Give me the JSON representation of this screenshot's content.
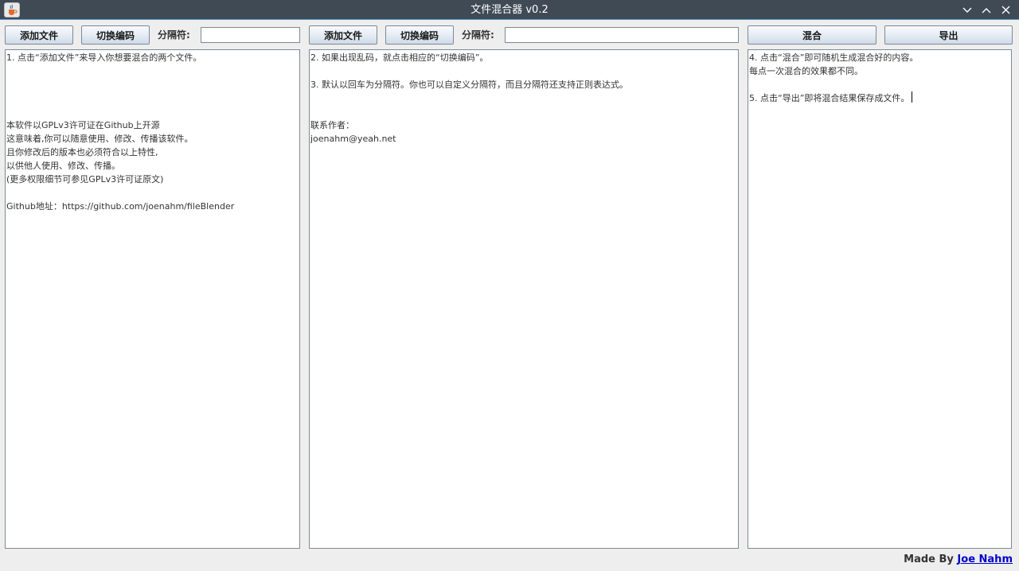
{
  "window": {
    "title": "文件混合器 v0.2",
    "icon": "java-cup-icon",
    "controls": [
      "minimize-icon",
      "maximize-icon",
      "close-icon"
    ]
  },
  "left_panel": {
    "add_file_label": "添加文件",
    "switch_encoding_label": "切换编码",
    "separator_label": "分隔符:",
    "separator_value": "",
    "lines": [
      "1. 点击“添加文件”来导入你想要混合的两个文件。",
      "",
      "",
      "",
      "",
      "本软件以GPLv3许可证在Github上开源",
      "这意味着,你可以随意使用、修改、传播该软件。",
      "且你修改后的版本也必须符合以上特性,",
      "以供他人使用、修改、传播。",
      "(更多权限细节可参见GPLv3许可证原文)",
      "",
      "Github地址：https://github.com/joenahm/fileBlender"
    ]
  },
  "middle_panel": {
    "add_file_label": "添加文件",
    "switch_encoding_label": "切换编码",
    "separator_label": "分隔符:",
    "separator_value": "",
    "lines": [
      "2. 如果出现乱码，就点击相应的“切换编码”。",
      "",
      "3. 默认以回车为分隔符。你也可以自定义分隔符，而且分隔符还支持正则表达式。",
      "",
      "",
      "联系作者：",
      "joenahm@yeah.net"
    ]
  },
  "right_panel": {
    "blend_label": "混合",
    "export_label": "导出",
    "lines": [
      "4. 点击“混合”即可随机生成混合好的内容。",
      "每点一次混合的效果都不同。",
      "",
      "5. 点击“导出”即将混合结果保存成文件。"
    ]
  },
  "footer": {
    "prefix": "Made By ",
    "author_link": "Joe Nahm"
  },
  "colors": {
    "titlebar": "#3f4a55",
    "link": "#0000cc",
    "background": "#eeeeee"
  }
}
